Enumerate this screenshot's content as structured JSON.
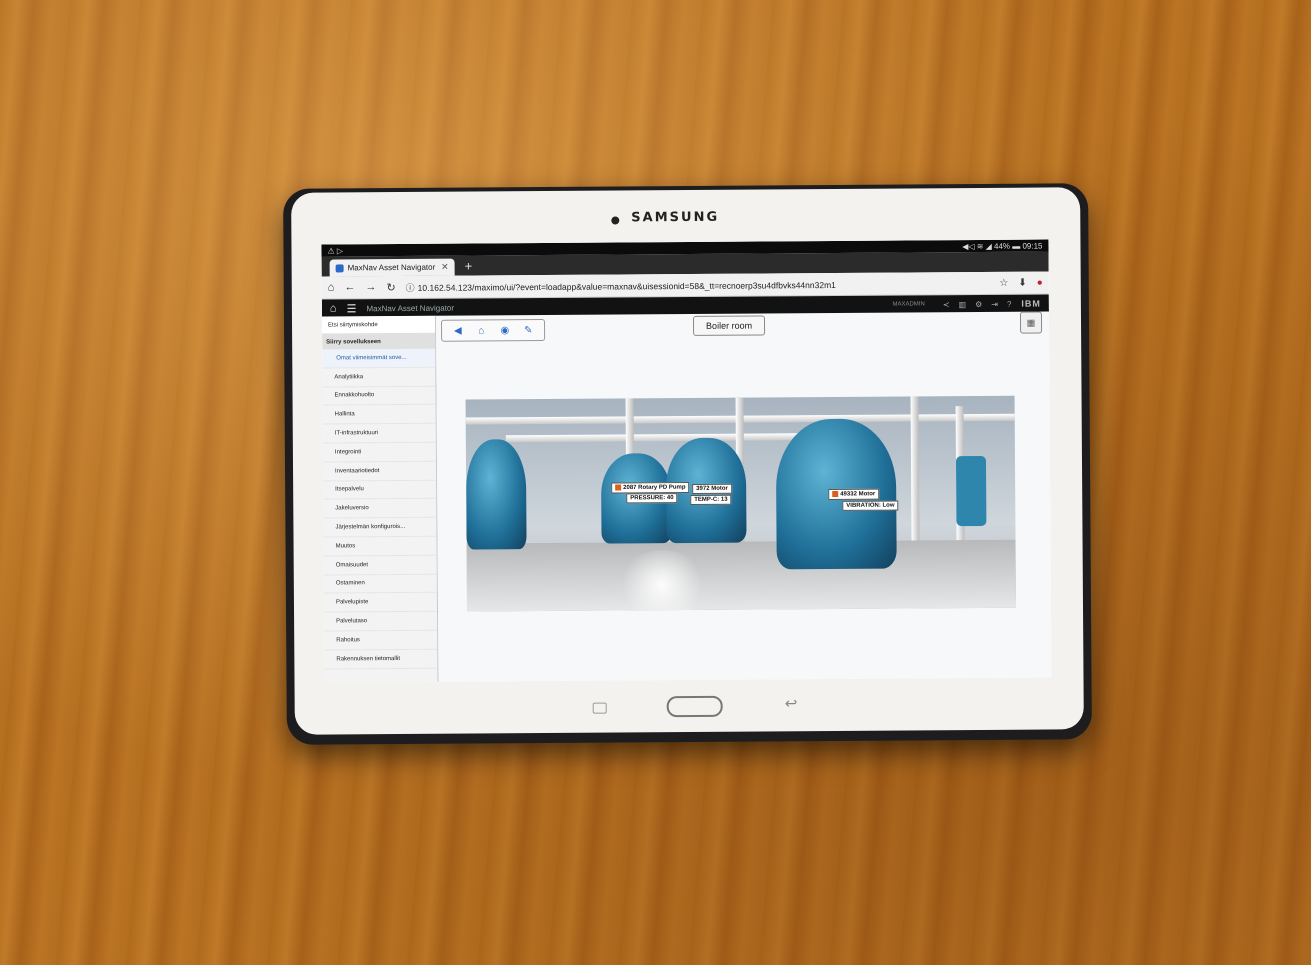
{
  "device": {
    "brand": "SAMSUNG"
  },
  "status_bar": {
    "left": "⚠ ▷",
    "right": "◀◁ ≋ ◢ 44% ▬ 09:15"
  },
  "browser": {
    "tab_title": "MaxNav Asset Navigator",
    "new_tab": "+",
    "url": "10.162.54.123/maximo/ui/?event=loadapp&value=maxnav&uisessionid=58&_tt=recnoerp3su4dfbvks44nn32m1"
  },
  "app": {
    "title": "MaxNav Asset Navigator",
    "user": "MAXADMIN",
    "brand": "IBM"
  },
  "sidebar": {
    "search": "Etsi siirtymiskohde",
    "section": "Siirry sovellukseen",
    "recent": "Omat viimeisimmät sove...",
    "items": [
      "Analytiikka",
      "Ennakkohuolto",
      "Hallinta",
      "IT-infrastruktuuri",
      "Integrointi",
      "Inventaariotiedot",
      "Itsepalvelu",
      "Jakeluversio",
      "Järjestelmän konfigurois...",
      "Muutos",
      "Omaisuudet",
      "Ostaminen",
      "Palvelupiste",
      "Palvelutaso",
      "Rahoitus",
      "Rakennuksen tietomallit"
    ]
  },
  "main": {
    "location": "Boiler room",
    "tags": [
      {
        "name": "2087 Rotary PD Pump",
        "reading": "PRESSURE: 40"
      },
      {
        "name": "3972 Motor",
        "reading": "TEMP-C: 13"
      },
      {
        "name": "49332 Motor",
        "reading": "VIBRATION: Low"
      }
    ]
  }
}
